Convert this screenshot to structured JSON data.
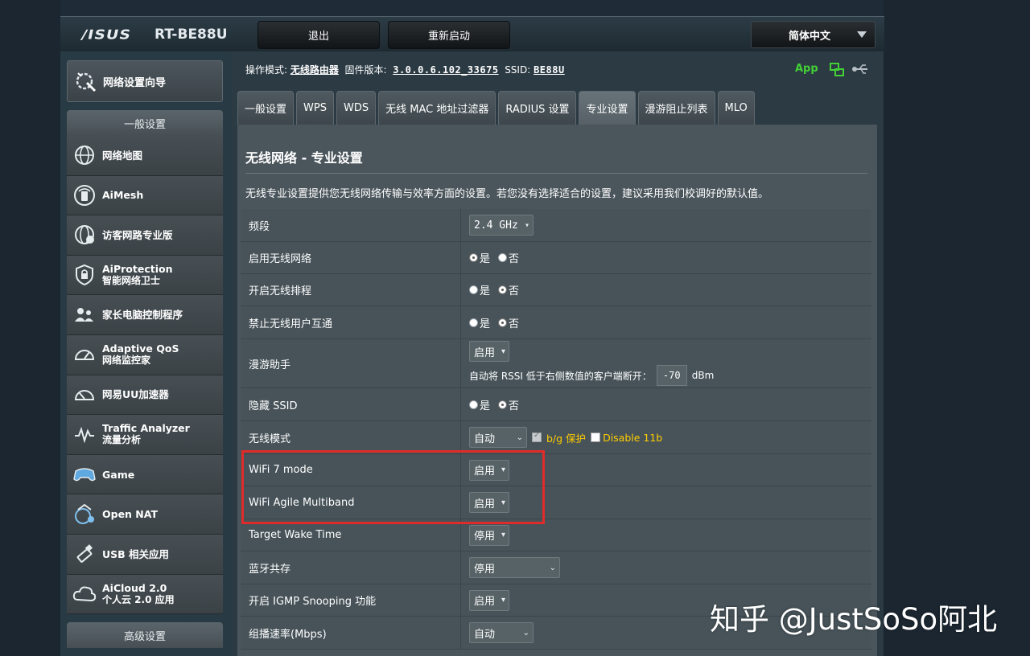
{
  "header": {
    "brand": "/ISUS",
    "model": "RT-BE88U",
    "logout_label": "退出",
    "reboot_label": "重新启动",
    "language": "简体中文"
  },
  "sidebar": {
    "wizard_label": "网络设置向导",
    "general_header": "一般设置",
    "advanced_header": "高级设置",
    "items": [
      {
        "label": "网络地图",
        "sub": "",
        "icon": "globe-icon"
      },
      {
        "label": "AiMesh",
        "sub": "",
        "icon": "aimesh-icon"
      },
      {
        "label": "访客网路专业版",
        "sub": "",
        "icon": "guest-network-icon"
      },
      {
        "label": "AiProtection",
        "sub": "智能网络卫士",
        "icon": "shield-icon"
      },
      {
        "label": "家长电脑控制程序",
        "sub": "",
        "icon": "parental-control-icon"
      },
      {
        "label": "Adaptive QoS",
        "sub": "网络监控家",
        "icon": "speedometer-icon"
      },
      {
        "label": "网易UU加速器",
        "sub": "",
        "icon": "accelerator-icon"
      },
      {
        "label": "Traffic Analyzer",
        "sub": "流量分析",
        "icon": "traffic-icon"
      },
      {
        "label": "Game",
        "sub": "",
        "icon": "gamepad-icon"
      },
      {
        "label": "Open NAT",
        "sub": "",
        "icon": "open-nat-icon"
      },
      {
        "label": "USB 相关应用",
        "sub": "",
        "icon": "usb-icon"
      },
      {
        "label": "AiCloud 2.0",
        "sub": "个人云 2.0 应用",
        "icon": "cloud-icon"
      }
    ]
  },
  "status": {
    "mode_label": "操作模式:",
    "mode_value": "无线路由器",
    "fw_label": "固件版本:",
    "fw_value": "3.0.0.6.102_33675",
    "ssid_label": "SSID:",
    "ssid_value": "BE88U",
    "app_label": "App"
  },
  "tabs": [
    {
      "label": "一般设置",
      "active": false
    },
    {
      "label": "WPS",
      "active": false
    },
    {
      "label": "WDS",
      "active": false
    },
    {
      "label": "无线 MAC 地址过滤器",
      "active": false
    },
    {
      "label": "RADIUS 设置",
      "active": false
    },
    {
      "label": "专业设置",
      "active": true
    },
    {
      "label": "漫游阻止列表",
      "active": false
    },
    {
      "label": "MLO",
      "active": false
    }
  ],
  "panel": {
    "title": "无线网络 - 专业设置",
    "description": "无线专业设置提供您无线网络传输与效率方面的设置。若您没有选择适合的设置，建议采用我们校调好的默认值。"
  },
  "rows": {
    "band": {
      "label": "频段",
      "value": "2.4 GHz"
    },
    "enable_wireless": {
      "label": "启用无线网络",
      "yes": "是",
      "no": "否",
      "selected": "yes"
    },
    "schedule": {
      "label": "开启无线排程",
      "yes": "是",
      "no": "否",
      "selected": "no"
    },
    "isolation": {
      "label": "禁止无线用户互通",
      "yes": "是",
      "no": "否",
      "selected": "no"
    },
    "roaming": {
      "label": "漫游助手",
      "value": "启用",
      "desc": "自动将 RSSI 低于右侧数值的客户端断开：",
      "rssi": "-70",
      "unit": "dBm"
    },
    "hide_ssid": {
      "label": "隐藏 SSID",
      "yes": "是",
      "no": "否",
      "selected": "no"
    },
    "wireless_mode": {
      "label": "无线模式",
      "value": "自动",
      "bg_protect": "b/g 保护",
      "disable11b": "Disable 11b"
    },
    "wifi7": {
      "label": "WiFi 7 mode",
      "value": "启用"
    },
    "agile": {
      "label": "WiFi Agile Multiband",
      "value": "启用"
    },
    "twt": {
      "label": "Target Wake Time",
      "value": "停用"
    },
    "bluetooth": {
      "label": "蓝牙共存",
      "value": "停用"
    },
    "igmp": {
      "label": "开启 IGMP Snooping 功能",
      "value": "启用"
    },
    "multicast": {
      "label": "组播速率(Mbps)",
      "value": "自动"
    }
  },
  "watermark": "知乎 @JustSoSo阿北",
  "colors": {
    "highlight": "#e02b2b",
    "app_green": "#43d036",
    "warning": "#ffcc00"
  }
}
